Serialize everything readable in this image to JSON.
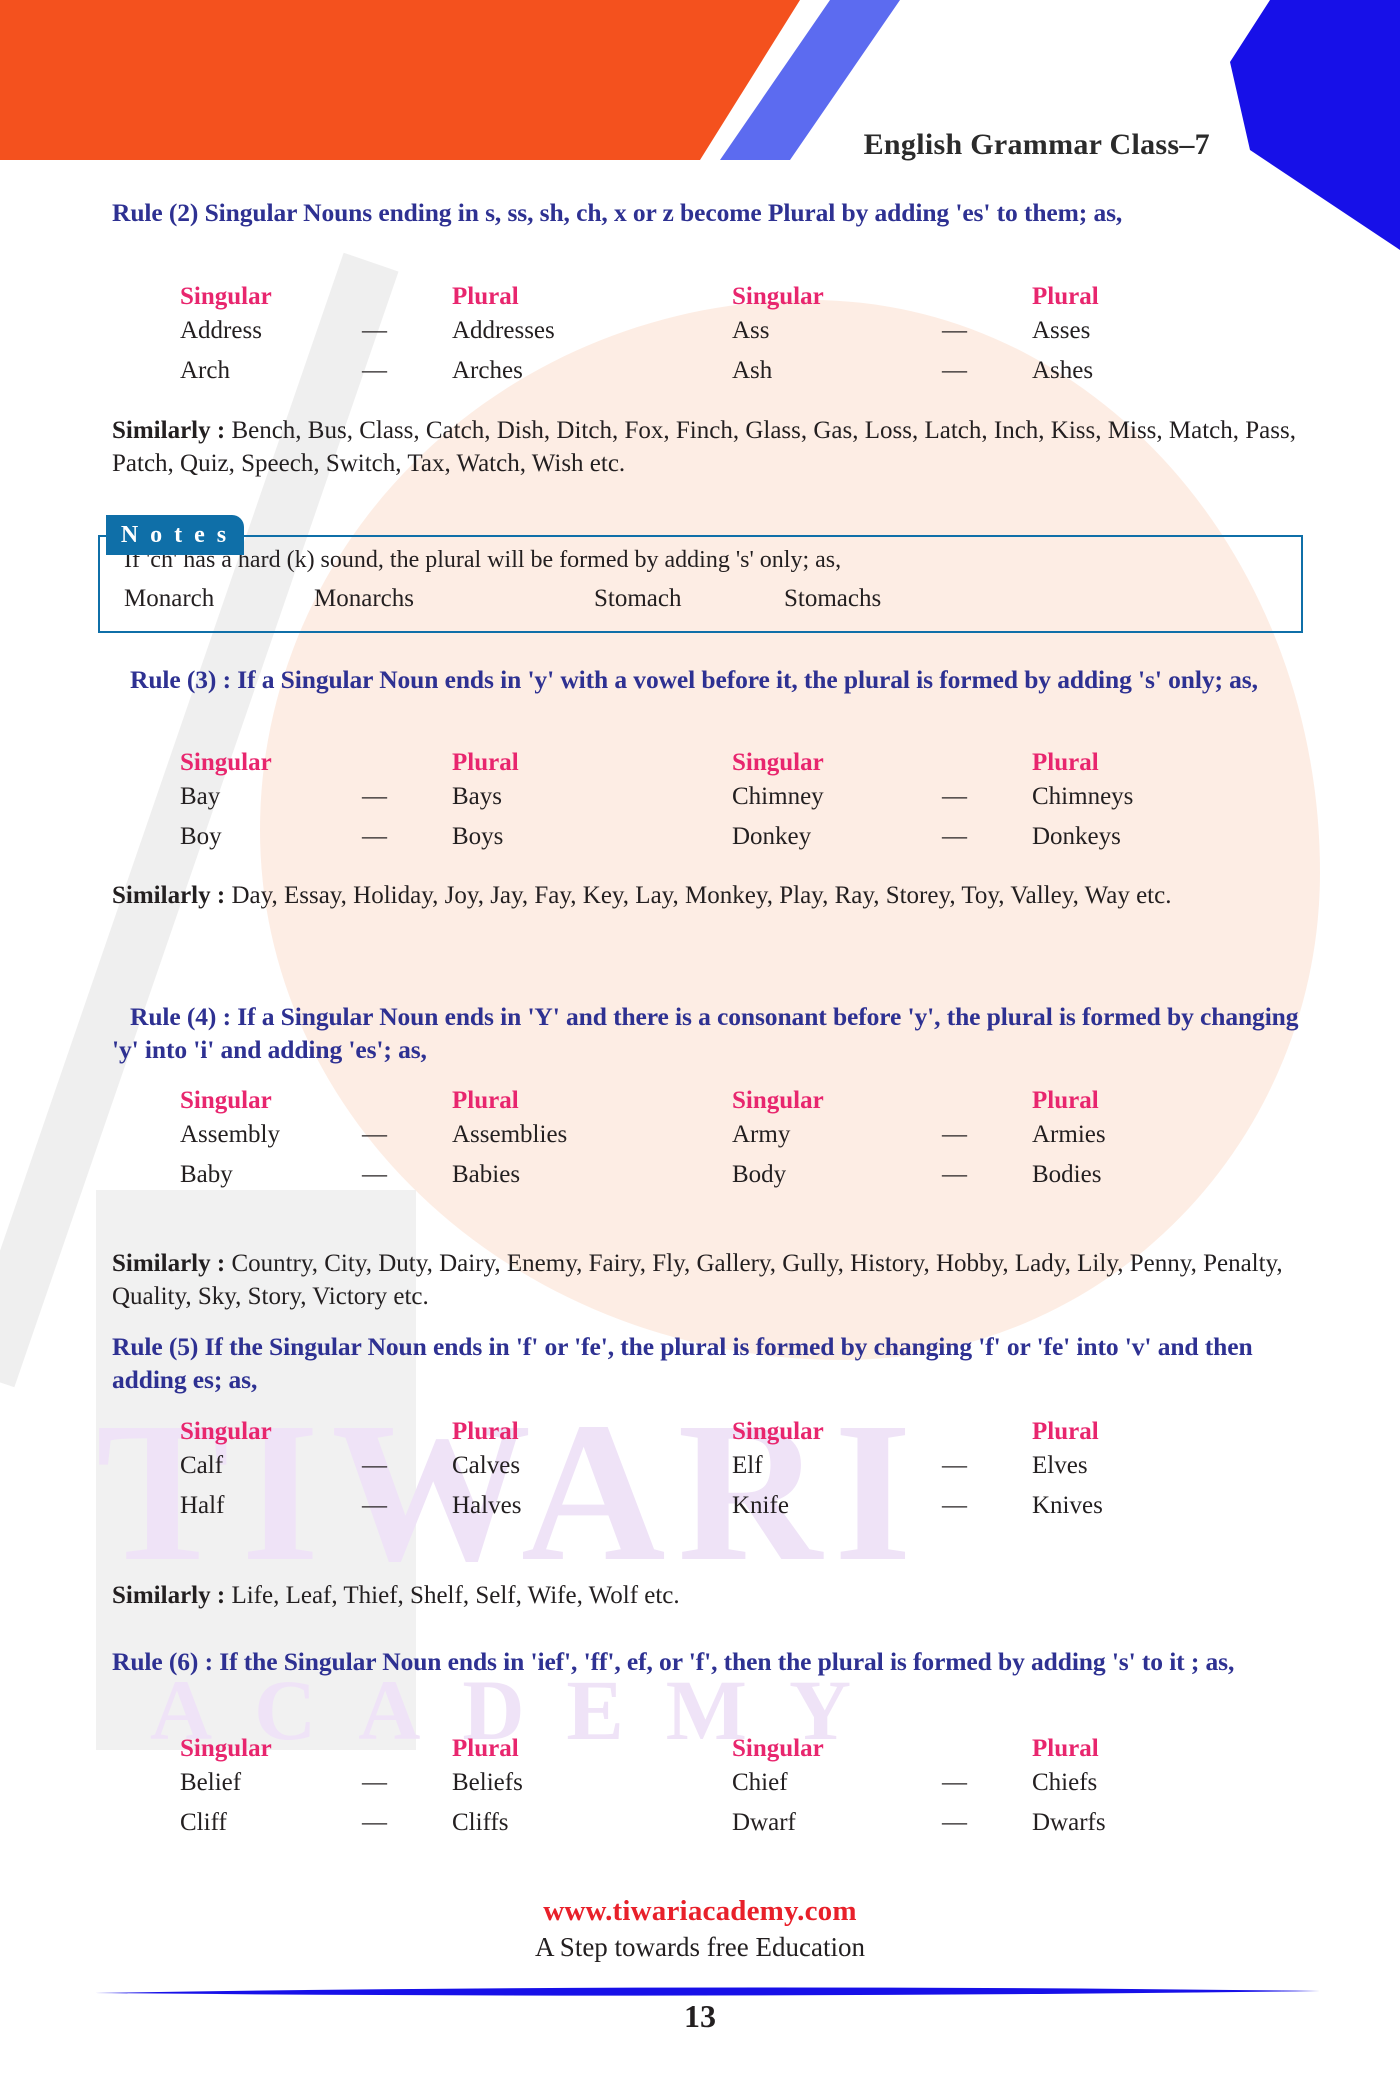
{
  "header": {
    "title": "English Grammar Class–7",
    "colors": {
      "orange": "#f4511e",
      "periwinkle": "#5c6bf0",
      "blue": "#1710e8"
    }
  },
  "watermark": {
    "line1": "TIWARI",
    "line2": "ACADEMY"
  },
  "table_headers": {
    "singular": "Singular",
    "plural": "Plural"
  },
  "rules": [
    {
      "id": "rule-2",
      "text": "Rule (2) Singular Nouns ending in s, ss, sh, ch, x or z become Plural by adding 'es' to them; as,",
      "rows": [
        {
          "s1": "Address",
          "d1": "—",
          "p1": "Addresses",
          "s2": "Ass",
          "d2": "—",
          "p2": "Asses"
        },
        {
          "s1": "Arch",
          "d1": "—",
          "p1": "Arches",
          "s2": "Ash",
          "d2": "—",
          "p2": "Ashes"
        }
      ],
      "similarly_label": "Similarly :",
      "similarly_text": " Bench, Bus, Class, Catch, Dish, Ditch, Fox, Finch, Glass, Gas, Loss, Latch, Inch, Kiss, Miss, Match, Pass, Patch, Quiz, Speech, Switch, Tax, Watch, Wish etc."
    },
    {
      "id": "rule-3",
      "text": "Rule (3) : If a Singular Noun ends in 'y' with a vowel before it, the plural is formed by adding 's' only; as,",
      "rows": [
        {
          "s1": "Bay",
          "d1": "—",
          "p1": "Bays",
          "s2": "Chimney",
          "d2": "—",
          "p2": "Chimneys"
        },
        {
          "s1": "Boy",
          "d1": "—",
          "p1": "Boys",
          "s2": "Donkey",
          "d2": "—",
          "p2": "Donkeys"
        }
      ],
      "similarly_label": "Similarly :",
      "similarly_text": " Day, Essay, Holiday, Joy, Jay, Fay, Key, Lay, Monkey, Play, Ray, Storey, Toy, Valley, Way etc."
    },
    {
      "id": "rule-4",
      "text": "Rule (4) : If a Singular Noun ends in 'Y' and there is a consonant before 'y', the plural is formed by  changing 'y' into 'i' and adding 'es'; as,",
      "rows": [
        {
          "s1": "Assembly",
          "d1": "—",
          "p1": "Assemblies",
          "s2": "Army",
          "d2": "—",
          "p2": "Armies"
        },
        {
          "s1": "Baby",
          "d1": "—",
          "p1": "Babies",
          "s2": "Body",
          "d2": "—",
          "p2": "Bodies"
        }
      ],
      "similarly_label": "Similarly :",
      "similarly_text": " Country, City, Duty, Dairy, Enemy, Fairy, Fly, Gallery, Gully, History, Hobby, Lady, Lily, Penny, Penalty, Quality, Sky, Story, Victory etc."
    },
    {
      "id": "rule-5",
      "text": "Rule (5) If the Singular Noun ends in 'f' or 'fe', the plural is formed by changing 'f' or 'fe' into 'v' and then adding es; as,",
      "rows": [
        {
          "s1": "Calf",
          "d1": "—",
          "p1": "Calves",
          "s2": "Elf",
          "d2": "—",
          "p2": "Elves"
        },
        {
          "s1": "Half",
          "d1": "—",
          "p1": "Halves",
          "s2": "Knife",
          "d2": "—",
          "p2": "Knives"
        }
      ],
      "similarly_label": "Similarly :",
      "similarly_text": " Life, Leaf, Thief, Shelf, Self, Wife, Wolf etc."
    },
    {
      "id": "rule-6",
      "text": "Rule (6) : If the Singular Noun ends in 'ief', 'ff', ef, or 'f', then the plural is formed by adding 's' to it ; as,",
      "rows": [
        {
          "s1": "Belief",
          "d1": "—",
          "p1": "Beliefs",
          "s2": "Chief",
          "d2": "—",
          "p2": "Chiefs"
        },
        {
          "s1": "Cliff",
          "d1": "—",
          "p1": "Cliffs",
          "s2": "Dwarf",
          "d2": "—",
          "p2": "Dwarfs"
        }
      ]
    }
  ],
  "notes": {
    "tab_label": "N o t e s",
    "line": "If  'ch' has a hard (k) sound, the plural will be formed by adding 's' only; as,",
    "examples": {
      "s1": "Monarch",
      "p1": "Monarchs",
      "s2": "Stomach",
      "p2": "Stomachs"
    }
  },
  "footer": {
    "site": "www.tiwariacademy.com",
    "tagline": "A Step towards free Education",
    "page_number": "13"
  }
}
